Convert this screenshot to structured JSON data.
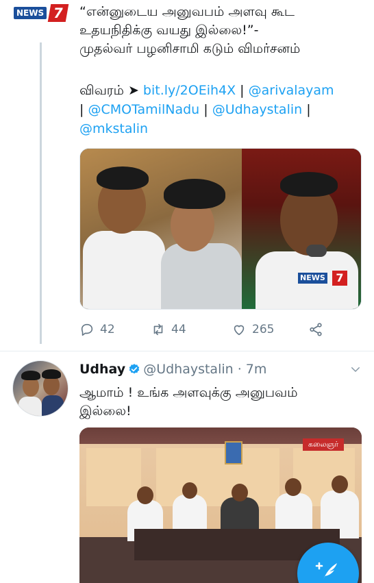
{
  "tweet1": {
    "author_logo": {
      "word": "NEWS",
      "number": "7"
    },
    "text_lines": [
      "“என்னுடைய அனுவபம் அளவு கூட",
      "உதயநிதிக்கு வயது இல்லை!”-",
      "முதல்வர் பழனிசாமி கடும் விமர்சனம்"
    ],
    "detail_prefix": "விவரம் ➤ ",
    "short_link": "bit.ly/2OEih4X",
    "mentions": [
      "@arivalayam",
      "@CMOTamilNadu",
      "@Udhaystalin",
      "@mkstalin"
    ],
    "separator": " | ",
    "media_watermark": {
      "word": "NEWS",
      "number": "7"
    },
    "counts": {
      "replies": "42",
      "retweets": "44",
      "likes": "265"
    },
    "icons": [
      "reply-icon",
      "retweet-icon",
      "like-icon",
      "share-icon"
    ]
  },
  "tweet2": {
    "name": "Udhay",
    "handle_time": "@Udhaystalin · 7m",
    "text_lines": [
      "ஆமாம் ! உங்க அளவுக்கு அனுபவம்",
      "இல்லை!"
    ],
    "media_logo": "கலைஞர்",
    "icons": [
      "verified-icon",
      "chevron-down-icon"
    ]
  },
  "compose": {
    "icon": "compose-tweet-icon"
  },
  "colors": {
    "link": "#1da1f2",
    "muted": "#657786",
    "text": "#14171a",
    "fab": "#1da1f2",
    "news_blue": "#1b4f9b",
    "news_red": "#d32020"
  }
}
